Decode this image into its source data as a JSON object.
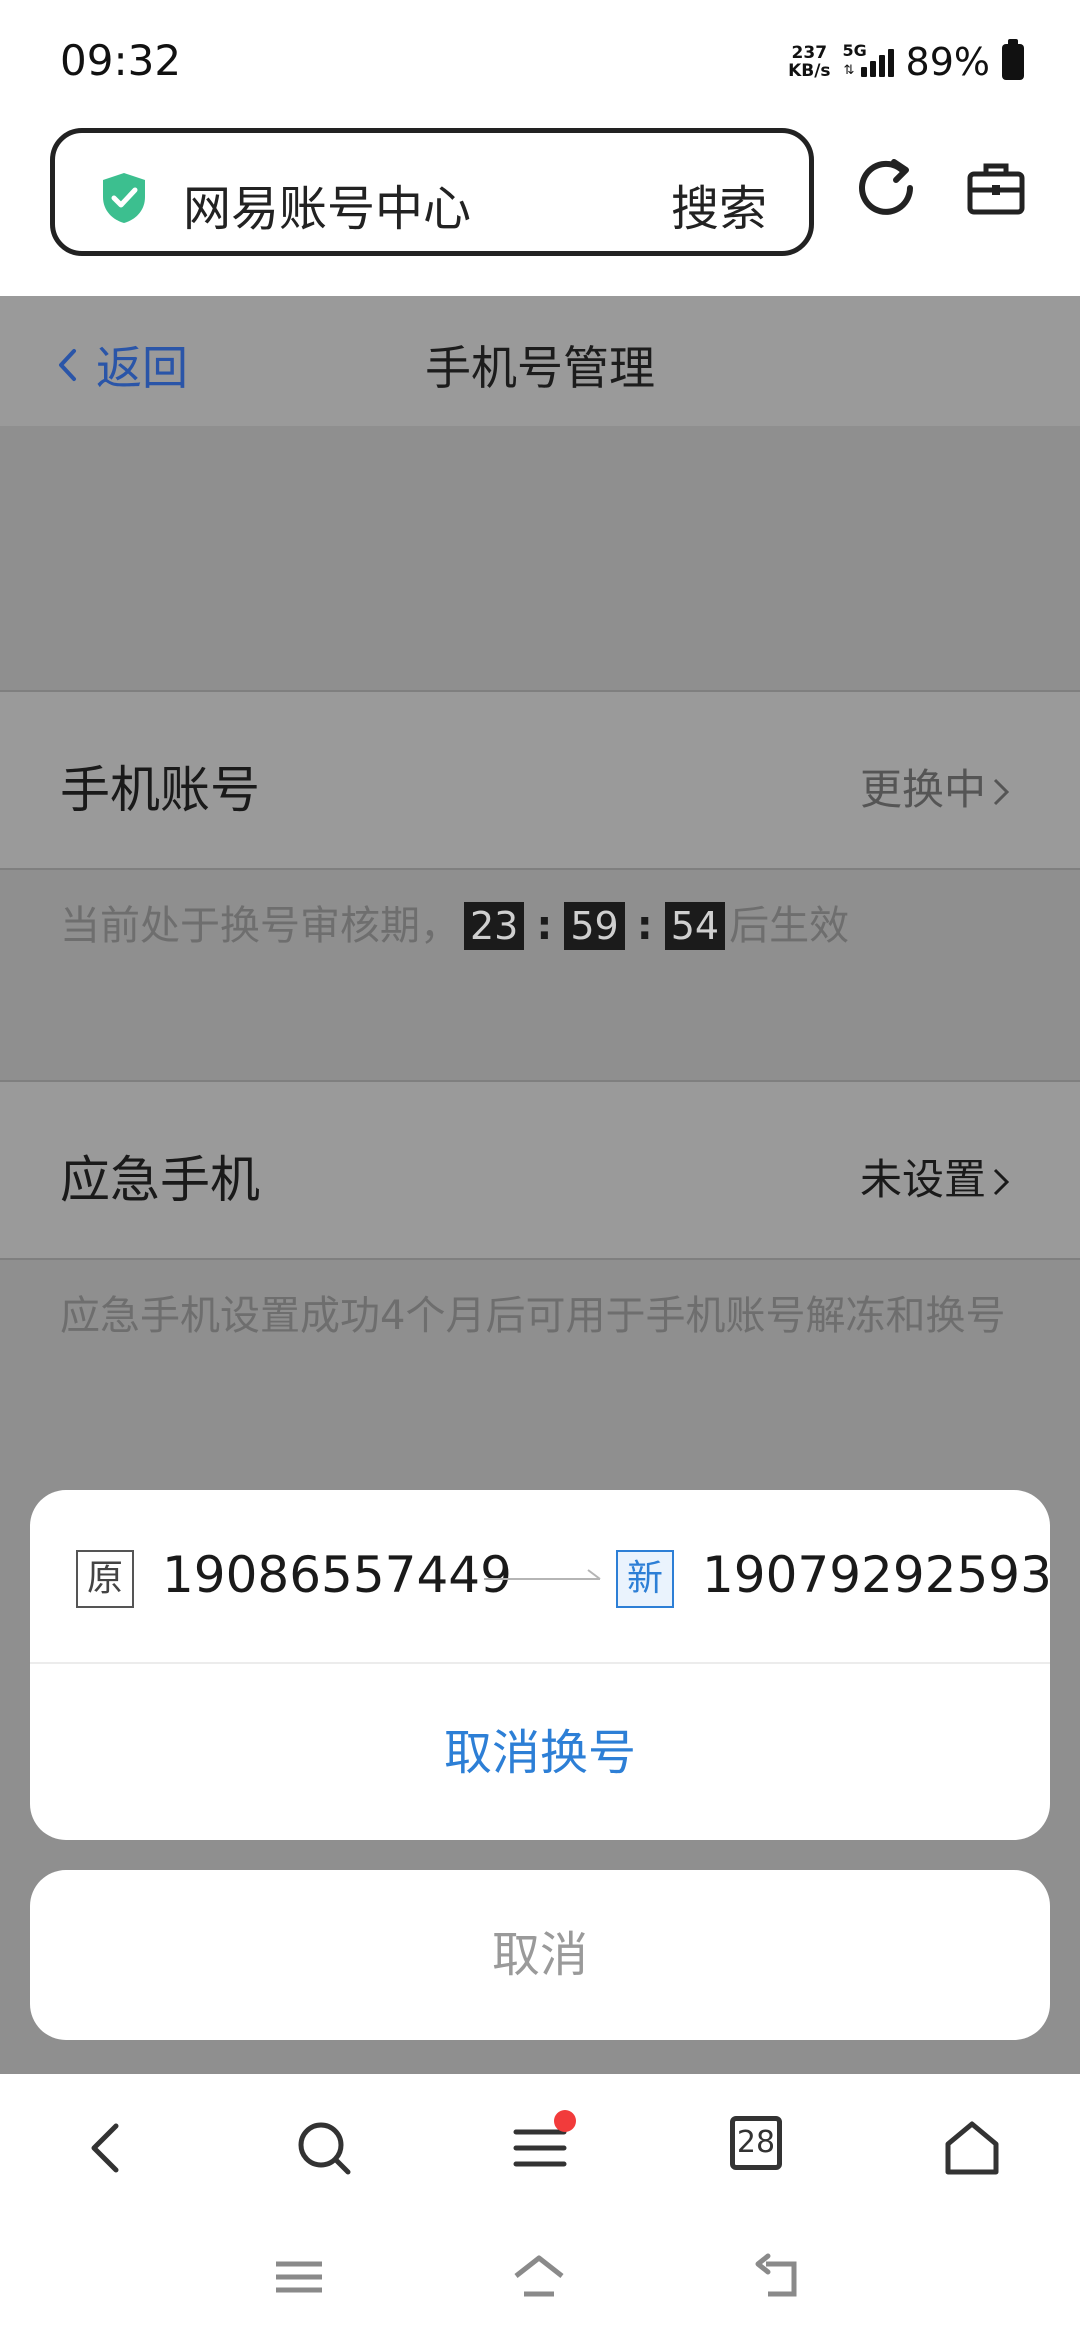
{
  "status_bar": {
    "time": "09:32",
    "net_speed_value": "237",
    "net_speed_unit": "KB/s",
    "network_type": "5G",
    "battery_percent": "89%"
  },
  "browser": {
    "site_title": "网易账号中心",
    "search_label": "搜索",
    "icons": [
      "shield-check-icon",
      "refresh-icon",
      "toolbox-icon"
    ]
  },
  "page": {
    "back_label": "返回",
    "title": "手机号管理",
    "phone_account": {
      "label": "手机账号",
      "status": "更换中",
      "note_prefix": "当前处于换号审核期，",
      "countdown": {
        "hours": "23",
        "minutes": "59",
        "seconds": "54"
      },
      "note_suffix": "后生效"
    },
    "emergency_phone": {
      "label": "应急手机",
      "status": "未设置",
      "note": "应急手机设置成功4个月后可用于手机账号解冻和换号"
    }
  },
  "action_sheet": {
    "old_badge": "原",
    "old_number": "19086557449",
    "new_badge": "新",
    "new_number": "19079292593",
    "cancel_swap_label": "取消换号",
    "cancel_label": "取消"
  },
  "bottom_toolbar": {
    "tab_count": "28",
    "icons": [
      "back-icon",
      "search-icon",
      "menu-icon",
      "tabs-icon",
      "home-icon"
    ]
  },
  "colors": {
    "accent_blue": "#2d7fd6",
    "link_blue": "#2a55a8",
    "shield_green": "#3cbf8f",
    "dim_overlay": "#8f8f8f",
    "notification_red": "#f23b3b"
  }
}
